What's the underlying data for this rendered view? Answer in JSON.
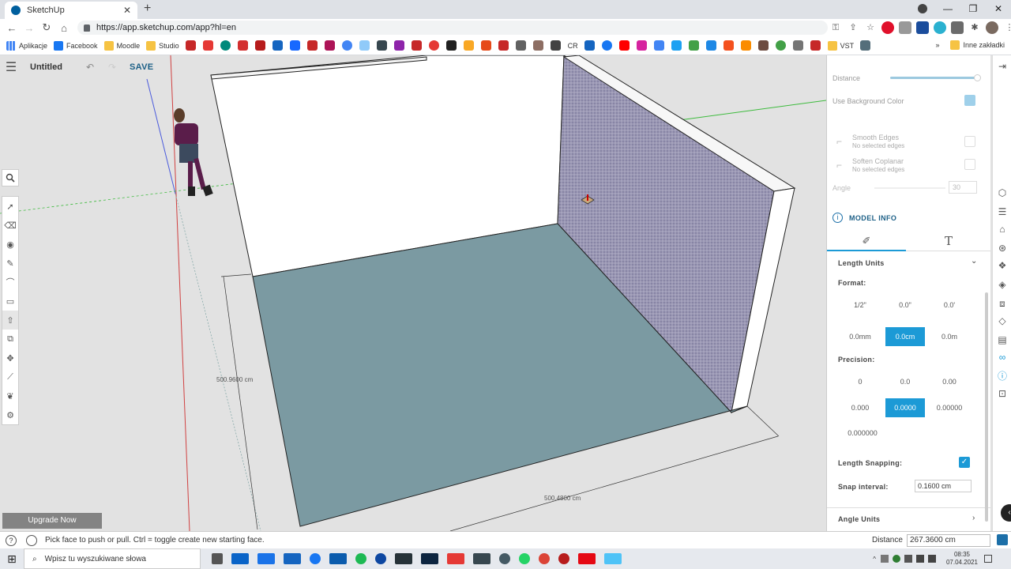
{
  "browser": {
    "tab_title": "SketchUp",
    "url": "https://app.sketchup.com/app?hl=en",
    "bookmarks": [
      "Aplikacje",
      "Facebook",
      "Moodle",
      "Studio"
    ],
    "bookmark_right": "Inne zakładki",
    "bookmark_text_items": [
      "VST",
      "CR"
    ]
  },
  "app": {
    "doc_title": "Untitled",
    "save_label": "SAVE",
    "upgrade_label": "Upgrade Now",
    "status_text": "Pick face to push or pull. Ctrl = toggle create new starting face.",
    "distance_label": "Distance",
    "distance_value": "267.3600 cm",
    "dims": {
      "left": "500.9600 cm",
      "bottom": "500.4800 cm"
    }
  },
  "panel": {
    "distance_label": "Distance",
    "use_bg_label": "Use Background Color",
    "smooth_edges": "Smooth Edges",
    "smooth_sub": "No selected edges",
    "soften_coplanar": "Soften Coplanar",
    "soften_sub": "No selected edges",
    "angle_label": "Angle",
    "angle_value": "30",
    "model_info": "MODEL INFO",
    "length_units": "Length Units",
    "format_label": "Format:",
    "formats": [
      "1/2\"",
      "0.0\"",
      "0.0'",
      "0.0mm",
      "0.0cm",
      "0.0m"
    ],
    "precision_label": "Precision:",
    "precisions": [
      "0",
      "0.0",
      "0.00",
      "0.000",
      "0.0000",
      "0.00000",
      "0.000000"
    ],
    "length_snapping": "Length Snapping:",
    "snap_interval_label": "Snap interval:",
    "snap_interval_value": "0.1600 cm",
    "angle_units": "Angle Units"
  },
  "taskbar": {
    "search_placeholder": "Wpisz tu wyszukiwane słowa",
    "time": "08:35",
    "date": "07.04.2021"
  },
  "colors": {
    "accent": "#1c9ad6",
    "floor": "#7b9aa2",
    "wall_back": "#9b98b4"
  }
}
